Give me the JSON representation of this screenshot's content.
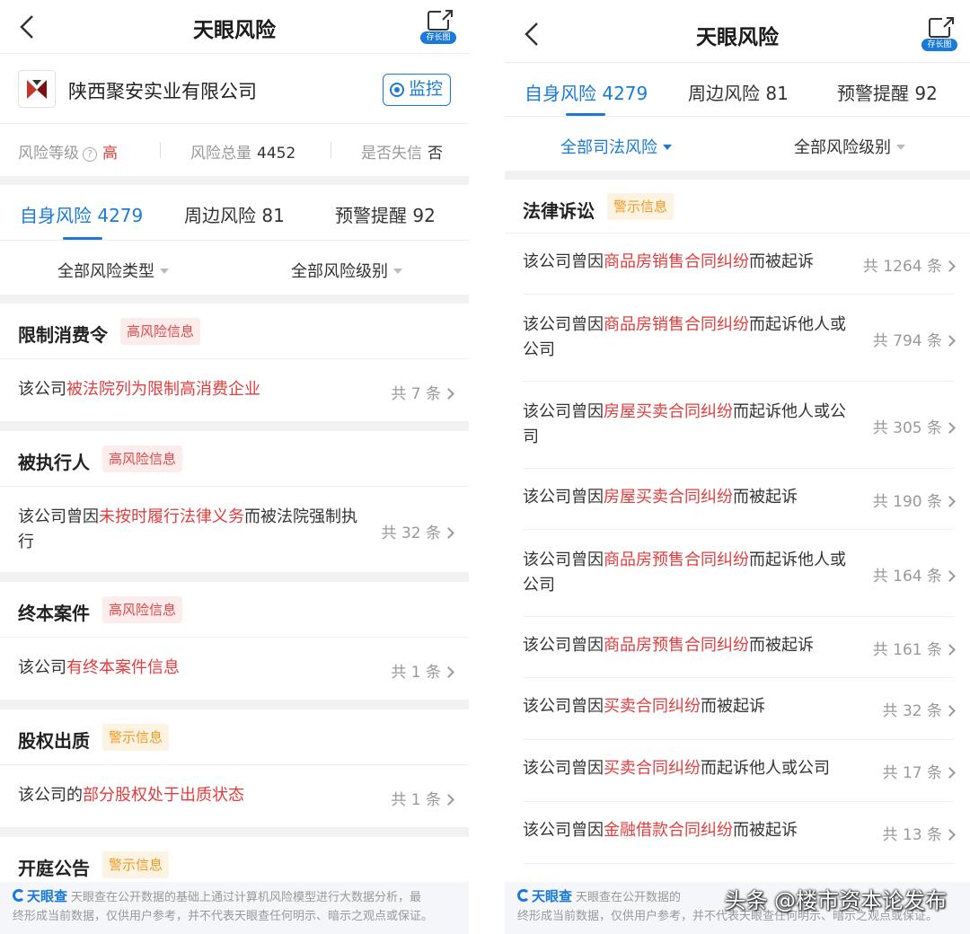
{
  "left": {
    "nav": {
      "title": "天眼风险",
      "share_label": "存长图"
    },
    "company": {
      "name": "陕西聚安实业有限公司",
      "monitor_label": "监控"
    },
    "stats": {
      "level_label": "风险等级",
      "level_value": "高",
      "total_label": "风险总量",
      "total_value": "4452",
      "dishonest_label": "是否失信",
      "dishonest_value": "否"
    },
    "tabs": [
      "自身风险 4279",
      "周边风险 81",
      "预警提醒 92"
    ],
    "filters": [
      "全部风险类型",
      "全部风险级别"
    ],
    "sections": [
      {
        "title": "限制消费令",
        "badge": "高风险信息",
        "rows": [
          {
            "pre": "该公司",
            "hl": "被法院列为限制高消费企业",
            "post": "",
            "count": "共 7 条"
          }
        ]
      },
      {
        "title": "被执行人",
        "badge": "高风险信息",
        "rows": [
          {
            "pre": "该公司曾因",
            "hl": "未按时履行法律义务",
            "post": "而被法院强制执行",
            "count": "共 32 条"
          }
        ]
      },
      {
        "title": "终本案件",
        "badge": "高风险信息",
        "rows": [
          {
            "pre": "该公司",
            "hl": "有终本案件信息",
            "post": "",
            "count": "共 1 条"
          }
        ]
      },
      {
        "title": "股权出质",
        "badge": "警示信息",
        "rows": [
          {
            "pre": "该公司的",
            "hl": "部分股权处于出质状态",
            "post": "",
            "count": "共 1 条"
          }
        ]
      },
      {
        "title": "开庭公告",
        "badge": "警示信息",
        "rows": []
      }
    ],
    "footer": {
      "brand": "天眼查",
      "line1": "天眼查在公开数据的基础上通过计算机风险模型进行大数据分析，最",
      "line2": "终形成当前数据，仅供用户参考，并不代表天眼查任何明示、暗示之观点或保证。"
    }
  },
  "right": {
    "nav": {
      "title": "天眼风险",
      "share_label": "存长图"
    },
    "tabs": [
      "自身风险 4279",
      "周边风险 81",
      "预警提醒 92"
    ],
    "filters": [
      "全部司法风险",
      "全部风险级别"
    ],
    "section": {
      "title": "法律诉讼",
      "badge": "警示信息"
    },
    "rows": [
      {
        "pre": "该公司曾因",
        "hl": "商品房销售合同纠纷",
        "post": "而被起诉",
        "count": "共 1264 条"
      },
      {
        "pre": "该公司曾因",
        "hl": "商品房销售合同纠纷",
        "post": "而起诉他人或公司",
        "count": "共 794 条"
      },
      {
        "pre": "该公司曾因",
        "hl": "房屋买卖合同纠纷",
        "post": "而起诉他人或公司",
        "count": "共 305 条"
      },
      {
        "pre": "该公司曾因",
        "hl": "房屋买卖合同纠纷",
        "post": "而被起诉",
        "count": "共 190 条"
      },
      {
        "pre": "该公司曾因",
        "hl": "商品房预售合同纠纷",
        "post": "而起诉他人或公司",
        "count": "共 164 条"
      },
      {
        "pre": "该公司曾因",
        "hl": "商品房预售合同纠纷",
        "post": "而被起诉",
        "count": "共 161 条"
      },
      {
        "pre": "该公司曾因",
        "hl": "买卖合同纠纷",
        "post": "而被起诉",
        "count": "共 32 条"
      },
      {
        "pre": "该公司曾因",
        "hl": "买卖合同纠纷",
        "post": "而起诉他人或公司",
        "count": "共 17 条"
      },
      {
        "pre": "该公司曾因",
        "hl": "金融借款合同纠纷",
        "post": "而被起诉",
        "count": "共 13 条"
      }
    ],
    "footer": {
      "brand": "天眼查",
      "line1": "天眼查在公开数据的",
      "line2": "终形成当前数据，仅供用户参考，并不代表天眼查任何明示、暗示之观点或保证。"
    },
    "watermark": "头条 @楼市资本论发布"
  },
  "colors": {
    "accent": "#1a7ad8",
    "danger": "#e03e3e",
    "warning": "#ef9a22"
  },
  "icons": [
    "back-icon",
    "share-icon",
    "eye-icon",
    "question-icon",
    "caret-down-icon",
    "chevron-right-icon",
    "tianyancha-logo-icon"
  ]
}
